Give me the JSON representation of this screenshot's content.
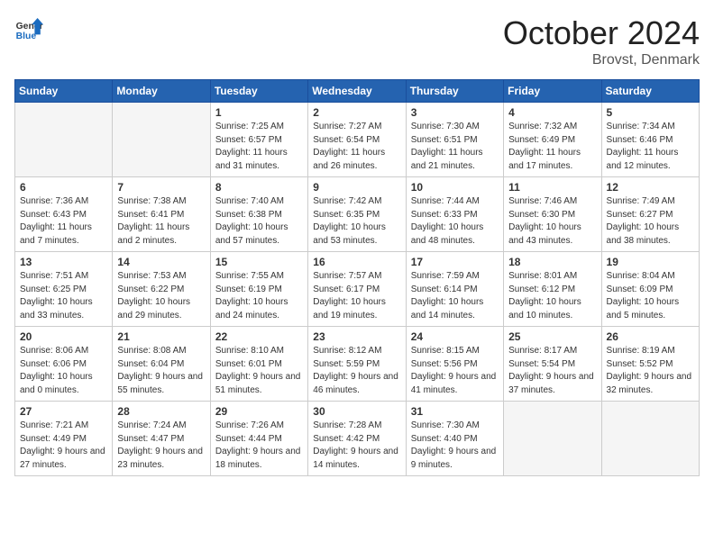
{
  "header": {
    "logo_general": "General",
    "logo_blue": "Blue",
    "month": "October 2024",
    "location": "Brovst, Denmark"
  },
  "days_of_week": [
    "Sunday",
    "Monday",
    "Tuesday",
    "Wednesday",
    "Thursday",
    "Friday",
    "Saturday"
  ],
  "weeks": [
    [
      {
        "day": "",
        "info": ""
      },
      {
        "day": "",
        "info": ""
      },
      {
        "day": "1",
        "info": "Sunrise: 7:25 AM\nSunset: 6:57 PM\nDaylight: 11 hours and 31 minutes."
      },
      {
        "day": "2",
        "info": "Sunrise: 7:27 AM\nSunset: 6:54 PM\nDaylight: 11 hours and 26 minutes."
      },
      {
        "day": "3",
        "info": "Sunrise: 7:30 AM\nSunset: 6:51 PM\nDaylight: 11 hours and 21 minutes."
      },
      {
        "day": "4",
        "info": "Sunrise: 7:32 AM\nSunset: 6:49 PM\nDaylight: 11 hours and 17 minutes."
      },
      {
        "day": "5",
        "info": "Sunrise: 7:34 AM\nSunset: 6:46 PM\nDaylight: 11 hours and 12 minutes."
      }
    ],
    [
      {
        "day": "6",
        "info": "Sunrise: 7:36 AM\nSunset: 6:43 PM\nDaylight: 11 hours and 7 minutes."
      },
      {
        "day": "7",
        "info": "Sunrise: 7:38 AM\nSunset: 6:41 PM\nDaylight: 11 hours and 2 minutes."
      },
      {
        "day": "8",
        "info": "Sunrise: 7:40 AM\nSunset: 6:38 PM\nDaylight: 10 hours and 57 minutes."
      },
      {
        "day": "9",
        "info": "Sunrise: 7:42 AM\nSunset: 6:35 PM\nDaylight: 10 hours and 53 minutes."
      },
      {
        "day": "10",
        "info": "Sunrise: 7:44 AM\nSunset: 6:33 PM\nDaylight: 10 hours and 48 minutes."
      },
      {
        "day": "11",
        "info": "Sunrise: 7:46 AM\nSunset: 6:30 PM\nDaylight: 10 hours and 43 minutes."
      },
      {
        "day": "12",
        "info": "Sunrise: 7:49 AM\nSunset: 6:27 PM\nDaylight: 10 hours and 38 minutes."
      }
    ],
    [
      {
        "day": "13",
        "info": "Sunrise: 7:51 AM\nSunset: 6:25 PM\nDaylight: 10 hours and 33 minutes."
      },
      {
        "day": "14",
        "info": "Sunrise: 7:53 AM\nSunset: 6:22 PM\nDaylight: 10 hours and 29 minutes."
      },
      {
        "day": "15",
        "info": "Sunrise: 7:55 AM\nSunset: 6:19 PM\nDaylight: 10 hours and 24 minutes."
      },
      {
        "day": "16",
        "info": "Sunrise: 7:57 AM\nSunset: 6:17 PM\nDaylight: 10 hours and 19 minutes."
      },
      {
        "day": "17",
        "info": "Sunrise: 7:59 AM\nSunset: 6:14 PM\nDaylight: 10 hours and 14 minutes."
      },
      {
        "day": "18",
        "info": "Sunrise: 8:01 AM\nSunset: 6:12 PM\nDaylight: 10 hours and 10 minutes."
      },
      {
        "day": "19",
        "info": "Sunrise: 8:04 AM\nSunset: 6:09 PM\nDaylight: 10 hours and 5 minutes."
      }
    ],
    [
      {
        "day": "20",
        "info": "Sunrise: 8:06 AM\nSunset: 6:06 PM\nDaylight: 10 hours and 0 minutes."
      },
      {
        "day": "21",
        "info": "Sunrise: 8:08 AM\nSunset: 6:04 PM\nDaylight: 9 hours and 55 minutes."
      },
      {
        "day": "22",
        "info": "Sunrise: 8:10 AM\nSunset: 6:01 PM\nDaylight: 9 hours and 51 minutes."
      },
      {
        "day": "23",
        "info": "Sunrise: 8:12 AM\nSunset: 5:59 PM\nDaylight: 9 hours and 46 minutes."
      },
      {
        "day": "24",
        "info": "Sunrise: 8:15 AM\nSunset: 5:56 PM\nDaylight: 9 hours and 41 minutes."
      },
      {
        "day": "25",
        "info": "Sunrise: 8:17 AM\nSunset: 5:54 PM\nDaylight: 9 hours and 37 minutes."
      },
      {
        "day": "26",
        "info": "Sunrise: 8:19 AM\nSunset: 5:52 PM\nDaylight: 9 hours and 32 minutes."
      }
    ],
    [
      {
        "day": "27",
        "info": "Sunrise: 7:21 AM\nSunset: 4:49 PM\nDaylight: 9 hours and 27 minutes."
      },
      {
        "day": "28",
        "info": "Sunrise: 7:24 AM\nSunset: 4:47 PM\nDaylight: 9 hours and 23 minutes."
      },
      {
        "day": "29",
        "info": "Sunrise: 7:26 AM\nSunset: 4:44 PM\nDaylight: 9 hours and 18 minutes."
      },
      {
        "day": "30",
        "info": "Sunrise: 7:28 AM\nSunset: 4:42 PM\nDaylight: 9 hours and 14 minutes."
      },
      {
        "day": "31",
        "info": "Sunrise: 7:30 AM\nSunset: 4:40 PM\nDaylight: 9 hours and 9 minutes."
      },
      {
        "day": "",
        "info": ""
      },
      {
        "day": "",
        "info": ""
      }
    ]
  ]
}
